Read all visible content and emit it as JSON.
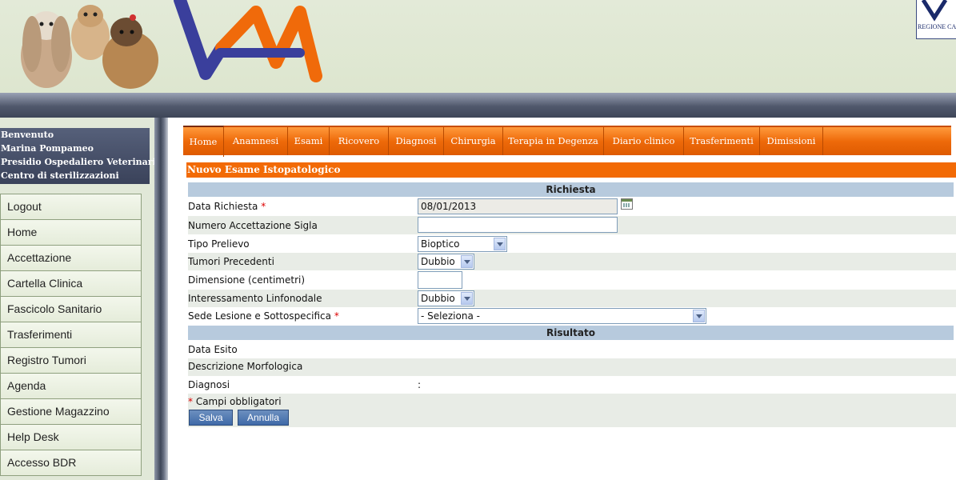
{
  "header": {
    "region_label": "REGIONE CAM"
  },
  "sidebar": {
    "welcome": {
      "greeting": "Benvenuto",
      "user": "Marina Pompameo",
      "facility": "Presidio Ospedaliero Veterinario",
      "center": "Centro di sterilizzazioni"
    },
    "menu": [
      "Logout",
      "Home",
      "Accettazione",
      "Cartella Clinica",
      "Fascicolo Sanitario",
      "Trasferimenti",
      "Registro Tumori",
      "Agenda",
      "Gestione Magazzino",
      "Help Desk",
      "Accesso BDR"
    ]
  },
  "tabs": [
    "Home",
    "Anamnesi",
    "Esami",
    "Ricovero",
    "Diagnosi",
    "Chirurgia",
    "Terapia in Degenza",
    "Diario clinico",
    "Trasferimenti",
    "Dimissioni"
  ],
  "form": {
    "title": "Nuovo Esame Istopatologico",
    "section_request": "Richiesta",
    "section_result": "Risultato",
    "fields": {
      "data_richiesta": {
        "label": "Data Richiesta",
        "value": "08/01/2013"
      },
      "numero_accettazione": {
        "label": "Numero Accettazione Sigla",
        "value": ""
      },
      "tipo_prelievo": {
        "label": "Tipo Prelievo",
        "value": "Bioptico"
      },
      "tumori_precedenti": {
        "label": "Tumori Precedenti",
        "value": "Dubbio"
      },
      "dimensione": {
        "label": "Dimensione (centimetri)",
        "value": ""
      },
      "interessamento": {
        "label": "Interessamento Linfonodale",
        "value": "Dubbio"
      },
      "sede_lesione": {
        "label": "Sede Lesione e Sottospecifica",
        "value": "- Seleziona -"
      }
    },
    "result": {
      "data_esito": "Data Esito",
      "descrizione": "Descrizione Morfologica",
      "diagnosi": "Diagnosi",
      "diagnosi_value": ":"
    },
    "required_marker": "*",
    "required_note": "Campi obbligatori",
    "save_label": "Salva",
    "cancel_label": "Annulla"
  },
  "colors": {
    "accent": "#f26a05",
    "section": "#b7cadd",
    "sidebar": "#e1e8d8"
  }
}
